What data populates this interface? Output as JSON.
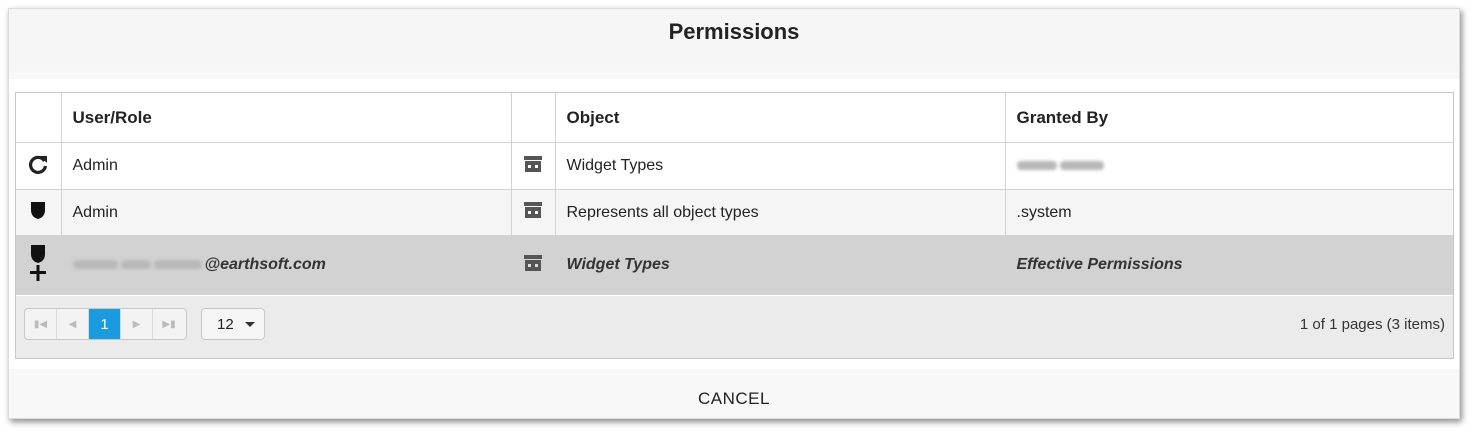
{
  "dialog": {
    "title": "Permissions",
    "cancel_label": "CANCEL"
  },
  "table": {
    "columns": [
      "",
      "User/Role",
      "",
      "Object",
      "Granted By"
    ],
    "rows": [
      {
        "type_icon": "refresh-icon",
        "user_role": "Admin",
        "object_icon": "archive-box-icon",
        "object": "Widget Types",
        "granted_by": ""
      },
      {
        "type_icon": "shield-icon",
        "user_role": "Admin",
        "object_icon": "archive-box-icon",
        "object": "Represents all object types",
        "granted_by": ".system"
      },
      {
        "type_icon": "user-effective-icon",
        "user_role": "@earthsoft.com",
        "object_icon": "archive-box-icon",
        "object": "Widget Types",
        "granted_by": "Effective Permissions"
      }
    ]
  },
  "pager": {
    "current_page": "1",
    "page_size": "12",
    "info": "1 of 1 pages (3 items)"
  },
  "colors": {
    "accent": "#1a9be0",
    "selected_row": "#d2d2d2"
  }
}
